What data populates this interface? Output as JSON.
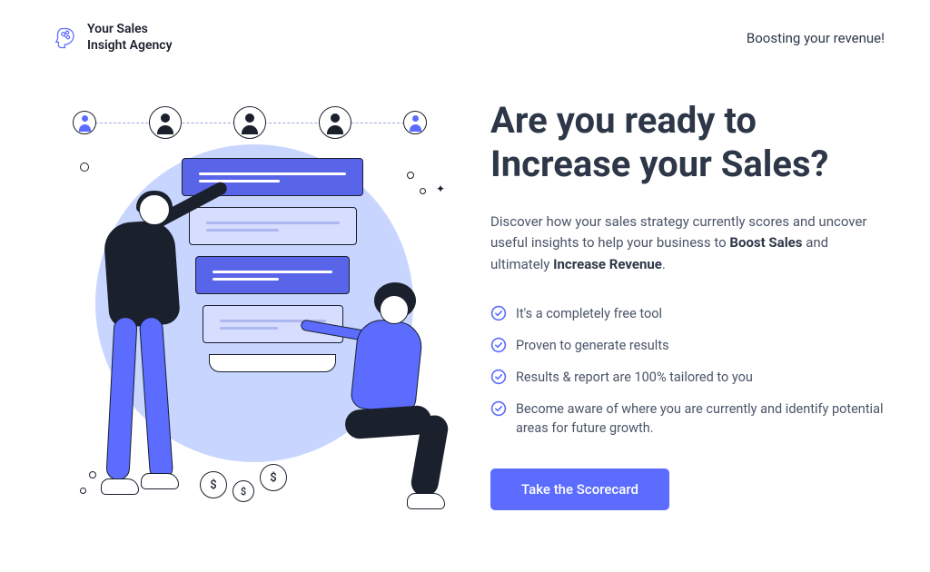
{
  "header": {
    "logo_line1": "Your Sales",
    "logo_line2": "Insight Agency",
    "tagline": "Boosting your revenue!"
  },
  "hero": {
    "heading": "Are you ready to Increase your Sales?",
    "description_pre": "Discover how your sales strategy currently scores and uncover useful insights to help your business to ",
    "description_bold1": "Boost Sales",
    "description_mid": " and ultimately ",
    "description_bold2": "Increase Revenue",
    "description_post": ".",
    "benefits": [
      "It's a completely free tool",
      "Proven to generate results",
      "Results & report are 100% tailored to you",
      "Become aware of where you are currently and identify potential areas for future growth."
    ],
    "cta_label": "Take the Scorecard"
  },
  "icons": {
    "check": "check-circle-icon",
    "logo": "brain-head-icon"
  },
  "colors": {
    "accent": "#5b6cff",
    "text_heading": "#2d3748",
    "text_body": "#4a5568",
    "illustration_bg": "#c7d5ff"
  }
}
